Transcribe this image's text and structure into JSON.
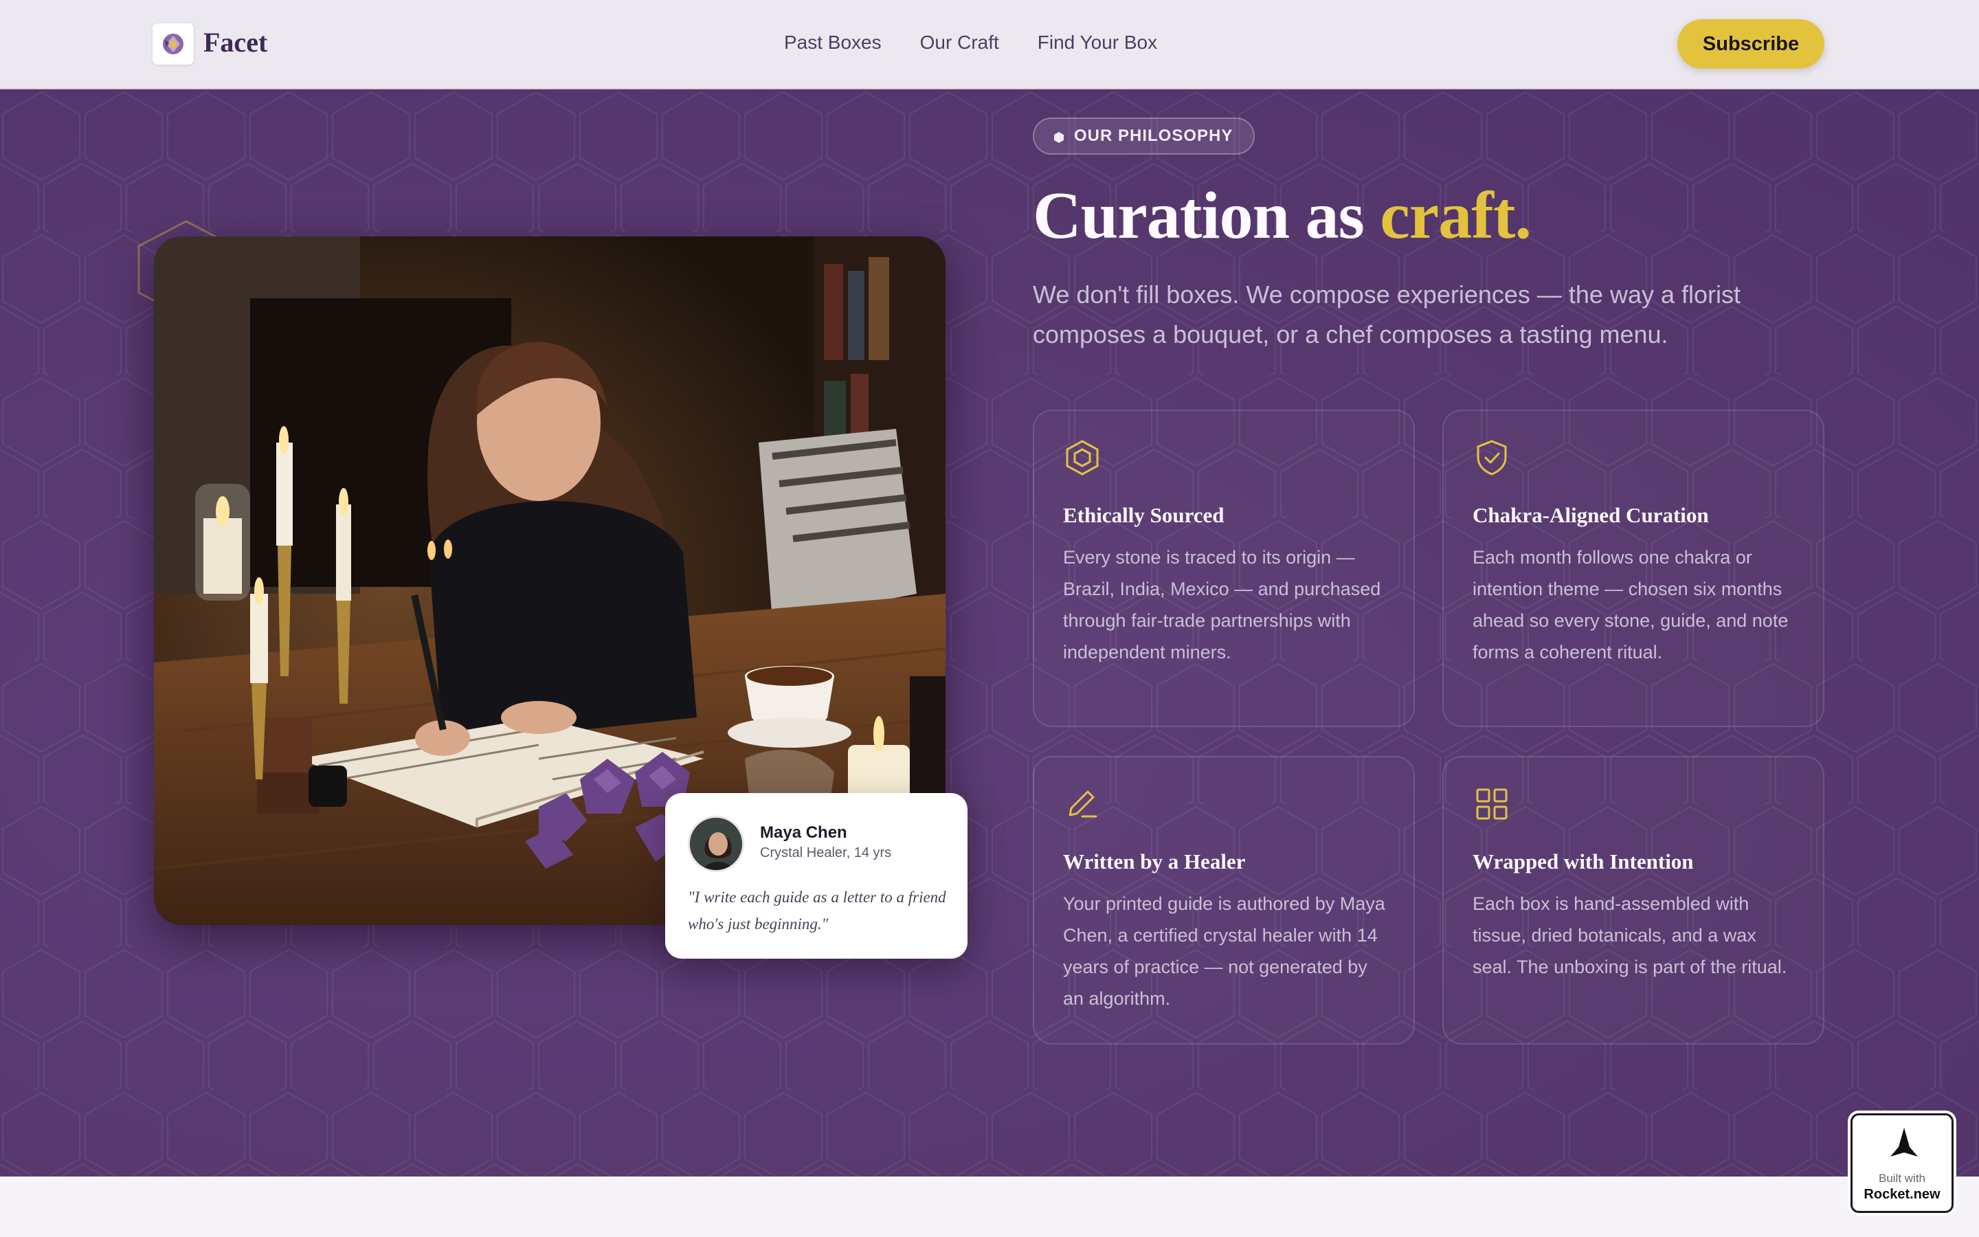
{
  "nav": {
    "brand": "Facet",
    "links": [
      "Past Boxes",
      "Our Craft",
      "Find Your Box"
    ],
    "cta": "Subscribe"
  },
  "hero": {
    "badge": "OUR PHILOSOPHY",
    "title_main": "Curation as ",
    "title_accent": "craft.",
    "lead": "We don't fill boxes. We compose experiences — the way a florist composes a bouquet, or a chef composes a tasting menu."
  },
  "quote": {
    "name": "Maya Chen",
    "role": "Crystal Healer, 14 yrs",
    "text": "\"I write each guide as a letter to a friend who's just beginning.\""
  },
  "features": [
    {
      "icon": "hexagon-icon",
      "title": "Ethically Sourced",
      "body": "Every stone is traced to its origin — Brazil, India, Mexico — and purchased through fair-trade partnerships with independent miners."
    },
    {
      "icon": "shield-check-icon",
      "title": "Chakra-Aligned Curation",
      "body": "Each month follows one chakra or intention theme — chosen six months ahead so every stone, guide, and note forms a coherent ritual."
    },
    {
      "icon": "pen-icon",
      "title": "Written by a Healer",
      "body": "Your printed guide is authored by Maya Chen, a certified crystal healer with 14 years of practice — not generated by an algorithm."
    },
    {
      "icon": "grid-icon",
      "title": "Wrapped with Intention",
      "body": "Each box is hand-assembled with tissue, dried botanicals, and a wax seal. The unboxing is part of the ritual."
    }
  ],
  "badge_built": {
    "small": "Built with",
    "large": "Rocket.new"
  },
  "colors": {
    "accent": "#e3c33d",
    "hero_bg": "#5b3a72",
    "nav_bg": "#ece8ef"
  }
}
